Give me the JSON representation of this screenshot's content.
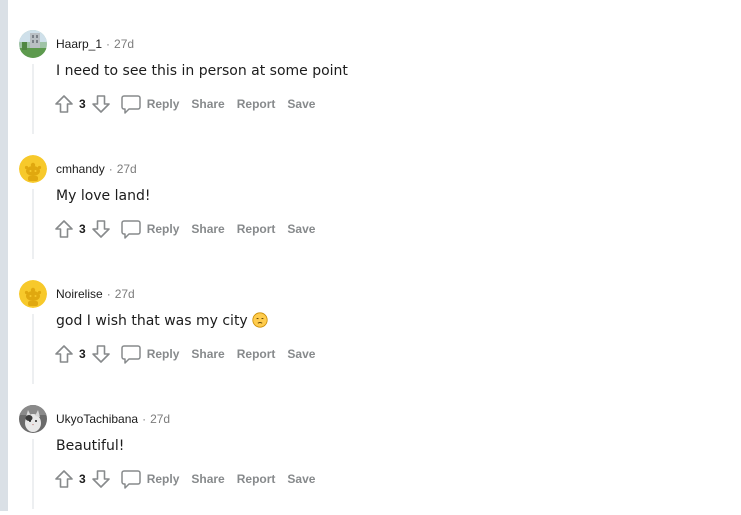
{
  "comments": [
    {
      "username": "Haarp_1",
      "time": "27d",
      "text": "I need to see this in person at some point",
      "score": "3",
      "avatar": "landscape-photo-avatar",
      "actions": {
        "reply": "Reply",
        "share": "Share",
        "report": "Report",
        "save": "Save"
      }
    },
    {
      "username": "cmhandy",
      "time": "27d",
      "text": "My love land!",
      "score": "3",
      "avatar": "default-snoo-avatar",
      "actions": {
        "reply": "Reply",
        "share": "Share",
        "report": "Report",
        "save": "Save"
      }
    },
    {
      "username": "Noirelise",
      "time": "27d",
      "text": "god I wish that was my city",
      "emoji": "disappointed-face-emoji",
      "score": "3",
      "avatar": "default-snoo-avatar",
      "actions": {
        "reply": "Reply",
        "share": "Share",
        "report": "Report",
        "save": "Save"
      }
    },
    {
      "username": "UkyoTachibana",
      "time": "27d",
      "text": "Beautiful!",
      "score": "3",
      "avatar": "cat-photo-avatar",
      "actions": {
        "reply": "Reply",
        "share": "Share",
        "report": "Report",
        "save": "Save"
      }
    }
  ],
  "colors": {
    "text": "#1c1c1c",
    "muted": "#7c7c7c",
    "action": "#878a8c",
    "snoo_yellow": "#f7c92b",
    "rail": "#dae0e6"
  }
}
